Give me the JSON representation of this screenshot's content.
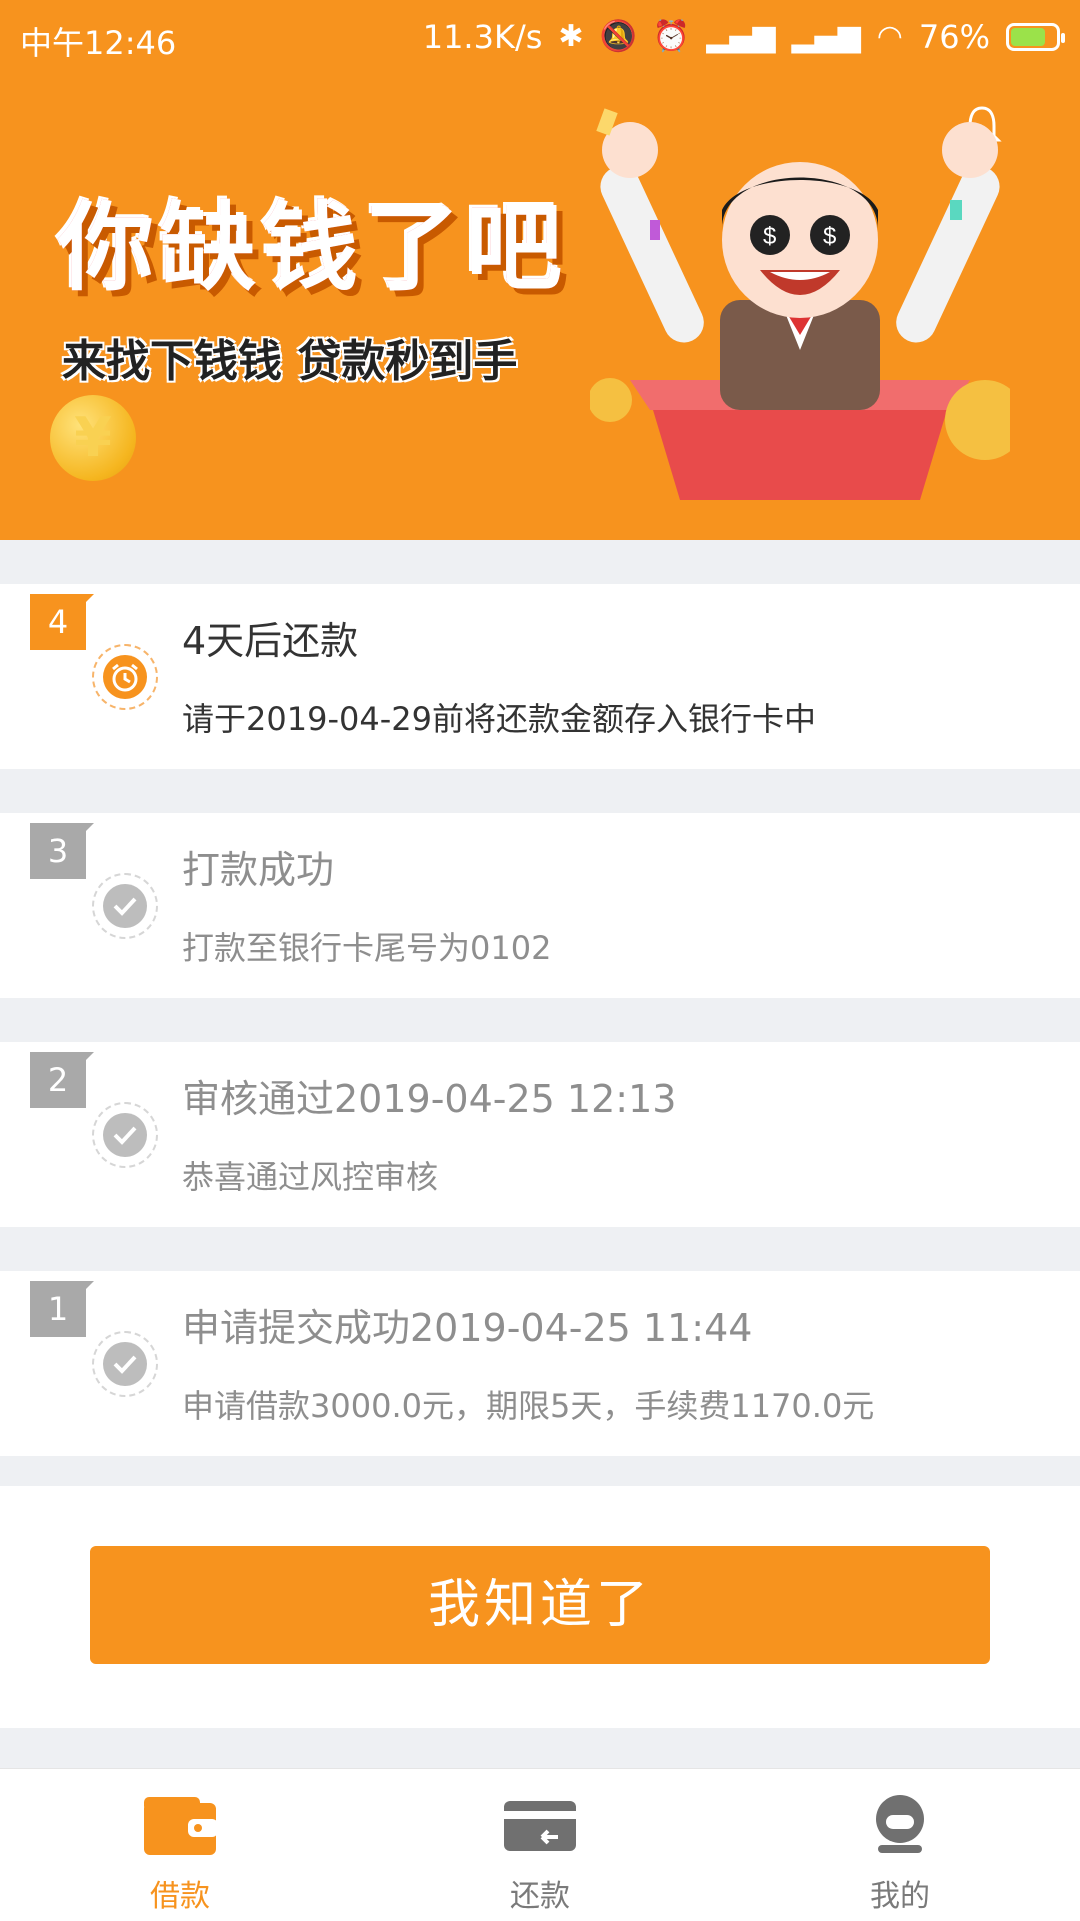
{
  "status_bar": {
    "time": "中午12:46",
    "speed": "11.3K/s",
    "battery": "76%"
  },
  "hero": {
    "title": "你缺钱了吧",
    "subtitle": "来找下钱钱 贷款秒到手",
    "coin_symbol": "¥"
  },
  "timeline": [
    {
      "step": "4",
      "title": "4天后还款",
      "subtitle": "请于2019-04-29前将还款金额存入银行卡中",
      "state": "active"
    },
    {
      "step": "3",
      "title": "打款成功",
      "subtitle": "打款至银行卡尾号为0102",
      "state": "done"
    },
    {
      "step": "2",
      "title": "审核通过2019-04-25 12:13",
      "subtitle": "恭喜通过风控审核",
      "state": "done"
    },
    {
      "step": "1",
      "title": "申请提交成功2019-04-25 11:44",
      "subtitle": "申请借款3000.0元，期限5天，手续费1170.0元",
      "state": "done"
    }
  ],
  "confirm_button": "我知道了",
  "bottom_nav": {
    "items": [
      {
        "label": "借款",
        "icon": "wallet-icon",
        "active": true
      },
      {
        "label": "还款",
        "icon": "card-return-icon",
        "active": false
      },
      {
        "label": "我的",
        "icon": "profile-icon",
        "active": false
      }
    ]
  },
  "colors": {
    "accent": "#f7931e",
    "inactive": "#a9a9a9",
    "background_gap": "#eef0f3"
  }
}
